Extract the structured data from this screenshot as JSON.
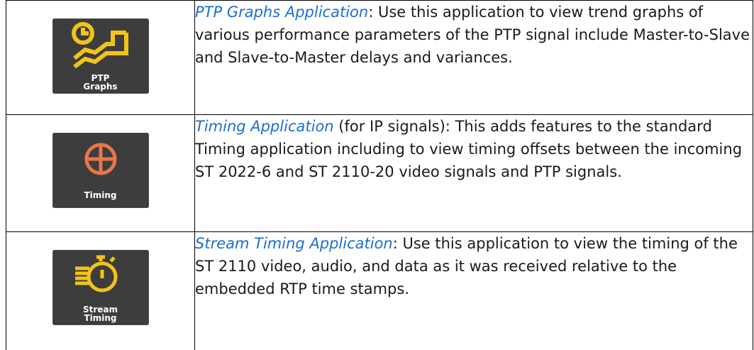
{
  "rows": [
    {
      "icon": "ptp-graphs-icon",
      "icon_color": "#f2c31a",
      "tile_label": [
        "PTP",
        "Graphs"
      ],
      "link": "PTP Graphs Application",
      "text": ": Use this application to view trend graphs of various performance parameters of the PTP signal include Master-to-Slave and Slave-to-Master delays and variances."
    },
    {
      "icon": "timing-icon",
      "icon_color": "#e8764a",
      "tile_label": [
        "Timing"
      ],
      "link": "Timing Application",
      "text": " (for IP signals): This adds features to the standard Timing application including to view timing offsets between the incoming ST 2022-6 and ST 2110-20 video signals and PTP signals."
    },
    {
      "icon": "stream-timing-icon",
      "icon_color": "#f2c31a",
      "tile_label": [
        "Stream",
        "Timing"
      ],
      "link": "Stream Timing Application",
      "text": ": Use this application to view the timing of the ST 2110 video, audio, and data as it was received relative to the embedded RTP time stamps."
    }
  ],
  "colors": {
    "link": "#1a6fd4",
    "tile_bg": "#3d3d3d",
    "border": "#000000"
  }
}
